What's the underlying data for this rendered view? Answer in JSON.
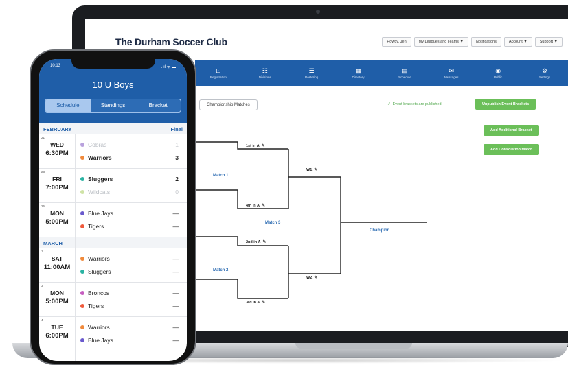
{
  "site": {
    "title": "The Durham Soccer Club",
    "top_links": [
      "Howdy, Jen",
      "My Leagues and Teams ▼",
      "Notifications",
      "Account ▼",
      "Support ▼"
    ]
  },
  "nav": {
    "items": [
      {
        "label": "Registration",
        "icon": "register-icon",
        "glyph": "⊡"
      },
      {
        "label": "Divisions",
        "icon": "divisions-icon",
        "glyph": "☷"
      },
      {
        "label": "Rostering",
        "icon": "rostering-icon",
        "glyph": "☰"
      },
      {
        "label": "Directory",
        "icon": "directory-icon",
        "glyph": "▦"
      },
      {
        "label": "Schedule",
        "icon": "calendar-icon",
        "glyph": "▤"
      },
      {
        "label": "Messages",
        "icon": "chat-icon",
        "glyph": "✉"
      },
      {
        "label": "Public",
        "icon": "globe-icon",
        "glyph": "◉"
      },
      {
        "label": "Settings",
        "icon": "gear-icon",
        "glyph": "⚙"
      }
    ]
  },
  "toolbar": {
    "tab": "Championship Matches",
    "published_note": "Event brackets are published",
    "unpublish_button": "Unpublish Event Brackets",
    "add_bracket_button": "Add Additional Bracket",
    "add_consolation_button": "Add Consolation Match"
  },
  "bracket": {
    "seeds": [
      "1st in A",
      "4th in A",
      "2nd in A",
      "3rd in A"
    ],
    "winners": [
      "W1",
      "W2"
    ],
    "matches": [
      "Match 1",
      "Match 2",
      "Match 3"
    ],
    "champion": "Champion"
  },
  "phone": {
    "status_time": "10:13",
    "status_icons": "..ıl ᯤ ▬",
    "title": "10 U Boys",
    "tabs": [
      "Schedule",
      "Standings",
      "Bracket"
    ],
    "active_tab": "Schedule",
    "months": [
      {
        "name": "FEBRUARY",
        "right": "Final"
      },
      {
        "name": "MARCH",
        "right": ""
      }
    ],
    "games": [
      {
        "day": "21",
        "dow": "WED",
        "time": "6:30PM",
        "home": {
          "name": "Cobras",
          "color": "#b9a2dd",
          "score": "1",
          "state": "loser"
        },
        "away": {
          "name": "Warriors",
          "color": "#f08a3c",
          "score": "3",
          "state": "winner"
        }
      },
      {
        "day": "23",
        "dow": "FRI",
        "time": "7:00PM",
        "home": {
          "name": "Sluggers",
          "color": "#2bb3a3",
          "score": "2",
          "state": "winner"
        },
        "away": {
          "name": "Wildcats",
          "color": "#cfe3a6",
          "score": "0",
          "state": "loser"
        }
      },
      {
        "day": "26",
        "dow": "MON",
        "time": "5:00PM",
        "home": {
          "name": "Blue Jays",
          "color": "#6a5acd",
          "score": "—",
          "state": "normal"
        },
        "away": {
          "name": "Tigers",
          "color": "#ef5a3c",
          "score": "—",
          "state": "normal"
        }
      },
      {
        "day": "1",
        "dow": "SAT",
        "time": "11:00AM",
        "home": {
          "name": "Warriors",
          "color": "#f08a3c",
          "score": "—",
          "state": "normal"
        },
        "away": {
          "name": "Sluggers",
          "color": "#2bb3a3",
          "score": "—",
          "state": "normal"
        }
      },
      {
        "day": "3",
        "dow": "MON",
        "time": "5:00PM",
        "home": {
          "name": "Broncos",
          "color": "#c65ec0",
          "score": "—",
          "state": "normal"
        },
        "away": {
          "name": "Tigers",
          "color": "#ef5a3c",
          "score": "—",
          "state": "normal"
        }
      },
      {
        "day": "4",
        "dow": "TUE",
        "time": "6:00PM",
        "home": {
          "name": "Warriors",
          "color": "#f08a3c",
          "score": "—",
          "state": "normal"
        },
        "away": {
          "name": "Blue Jays",
          "color": "#6a5acd",
          "score": "—",
          "state": "normal"
        }
      }
    ]
  },
  "colors": {
    "brand_blue": "#1f5ea8",
    "action_green": "#6bbf59"
  }
}
